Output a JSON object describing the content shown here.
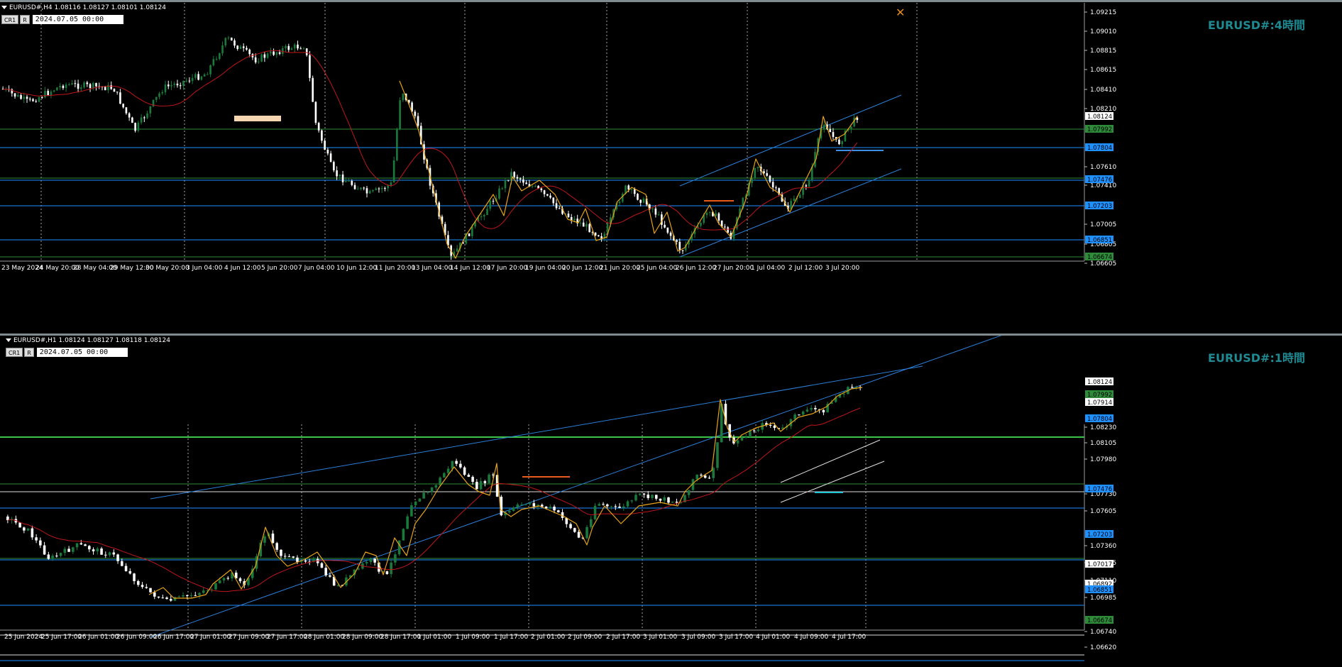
{
  "top": {
    "symbol_line": "EURUSD#,H4  1.08116 1.08127 1.08101 1.08124",
    "btn1": "CR1",
    "btn2": "R",
    "datetime": "2024.07.05 00:00",
    "watermark": "EURUSD#:4時間",
    "price_labels": [
      "1.09215",
      "1.09010",
      "1.08815",
      "1.08615",
      "1.08410",
      "1.08210",
      "1.07610",
      "1.07410",
      "1.07005",
      "1.06805",
      "1.06605"
    ],
    "price_tags": [
      {
        "text": "1.08124",
        "bg": "#ffffff",
        "fg": "#000000"
      },
      {
        "text": "1.07992",
        "bg": "#2e8b3a",
        "fg": "#000000"
      },
      {
        "text": "1.07804",
        "bg": "#1e90ff",
        "fg": "#000000"
      },
      {
        "text": "1.07476",
        "bg": "#1e90ff",
        "fg": "#000000"
      },
      {
        "text": "1.07203",
        "bg": "#1e90ff",
        "fg": "#000000"
      },
      {
        "text": "1.06851",
        "bg": "#1e90ff",
        "fg": "#000000"
      },
      {
        "text": "1.06674",
        "bg": "#2e8b3a",
        "fg": "#000000"
      }
    ],
    "time_labels": [
      "23 May 2024",
      "24 May 20:00",
      "28 May 04:00",
      "29 May 12:00",
      "30 May 20:00",
      "3 Jun 04:00",
      "4 Jun 12:00",
      "5 Jun 20:00",
      "7 Jun 04:00",
      "10 Jun 12:00",
      "11 Jun 20:00",
      "13 Jun 04:00",
      "14 Jun 12:00",
      "17 Jun 20:00",
      "19 Jun 04:00",
      "20 Jun 12:00",
      "21 Jun 20:00",
      "25 Jun 04:00",
      "26 Jun 12:00",
      "27 Jun 20:00",
      "1 Jul 04:00",
      "2 Jul 12:00",
      "3 Jul 20:00"
    ]
  },
  "bottom": {
    "symbol_line": "EURUSD#,H1  1.08124 1.08127 1.08118 1.08124",
    "btn1": "CR1",
    "btn2": "R",
    "datetime": "2024.07.05 00:00",
    "watermark": "EURUSD#:1時間",
    "price_labels": [
      "1.08230",
      "1.08105",
      "1.07980",
      "1.07730",
      "1.07605",
      "1.07360",
      "1.07235",
      "1.07110",
      "1.06985",
      "1.06740",
      "1.06620"
    ],
    "price_tags": [
      {
        "text": "1.08124",
        "bg": "#ffffff",
        "fg": "#000000"
      },
      {
        "text": "1.07992",
        "bg": "#2e8b3a",
        "fg": "#000000"
      },
      {
        "text": "1.07914",
        "bg": "#ffffff",
        "fg": "#000000"
      },
      {
        "text": "1.07804",
        "bg": "#1e90ff",
        "fg": "#000000"
      },
      {
        "text": "1.07476",
        "bg": "#1e90ff",
        "fg": "#000000"
      },
      {
        "text": "1.07203",
        "bg": "#1e90ff",
        "fg": "#000000"
      },
      {
        "text": "1.07017",
        "bg": "#ffffff",
        "fg": "#000000"
      },
      {
        "text": "1.06892",
        "bg": "#ffffff",
        "fg": "#000000"
      },
      {
        "text": "1.06851",
        "bg": "#1e90ff",
        "fg": "#000000"
      },
      {
        "text": "1.06674",
        "bg": "#2e8b3a",
        "fg": "#000000"
      }
    ],
    "time_labels": [
      "25 Jun 2024",
      "25 Jun 17:00",
      "26 Jun 01:00",
      "26 Jun 09:00",
      "26 Jun 17:00",
      "27 Jun 01:00",
      "27 Jun 09:00",
      "27 Jun 17:00",
      "28 Jun 01:00",
      "28 Jun 09:00",
      "28 Jun 17:00",
      "1 Jul 01:00",
      "1 Jul 09:00",
      "1 Jul 17:00",
      "2 Jul 01:00",
      "2 Jul 09:00",
      "2 Jul 17:00",
      "3 Jul 01:00",
      "3 Jul 09:00",
      "3 Jul 17:00",
      "4 Jul 01:00",
      "4 Jul 09:00",
      "4 Jul 17:00"
    ]
  },
  "colors": {
    "bull": "#1a7a3c",
    "bear": "#ffffff",
    "ma": "#c0161a",
    "zigzag": "#e8a317",
    "channel": "#2b7fd8",
    "level_blue": "#1e90ff",
    "level_green": "#2e8b3a",
    "grid": "#cfcfcf",
    "accent": "#1f8a92"
  }
}
